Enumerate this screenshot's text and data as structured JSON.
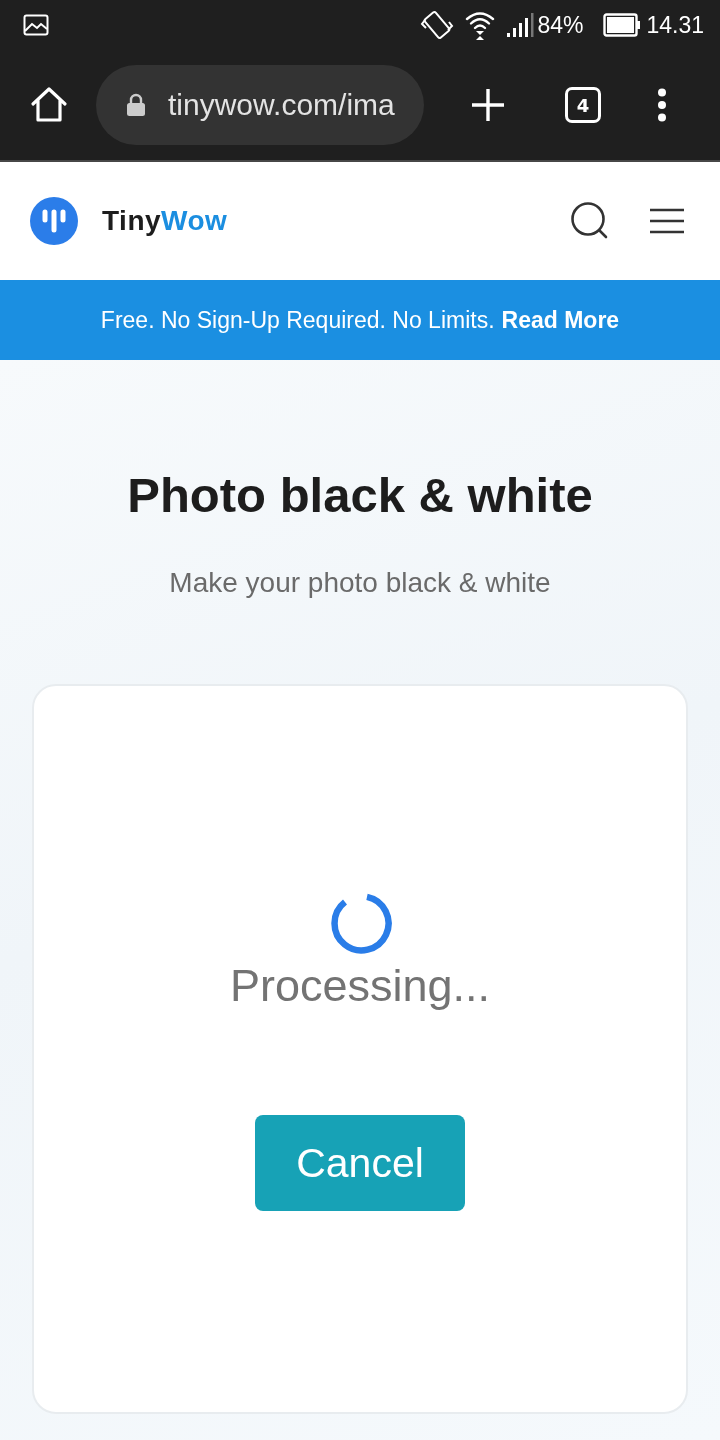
{
  "status_bar": {
    "battery": "84%",
    "time": "14.31"
  },
  "browser_toolbar": {
    "url": "tinywow.com/ima",
    "tab_count": "4"
  },
  "site_header": {
    "brand": [
      {
        "text": "Tiny",
        "accent": false
      },
      {
        "text": "Wow",
        "accent": true
      }
    ]
  },
  "banner": {
    "text": "Free. No Sign-Up Required. No Limits.",
    "link": "Read More"
  },
  "hero": {
    "title": "Photo black & white",
    "subtitle": "Make your photo black & white"
  },
  "processing_card": {
    "status": "Processing...",
    "button": "Cancel"
  }
}
